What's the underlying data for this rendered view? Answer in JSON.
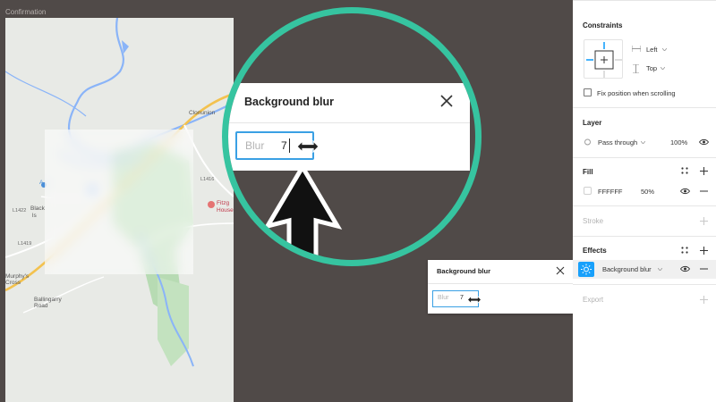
{
  "canvas": {
    "frame_label": "Confirmation",
    "map_labels": {
      "clonunion": "Clonunion",
      "fitzg": "Fitzg",
      "house": "House",
      "black": "Black",
      "ls": "ls",
      "l1422": "L1422",
      "l1419": "L1419",
      "l1416": "L1416",
      "murphys_cross": "Murphy's\nCross",
      "ballingarry_road": "Ballingarry\nRoad",
      "a_marker": "A"
    }
  },
  "zoom": {
    "title": "Background blur",
    "placeholder": "Blur",
    "value": "7"
  },
  "popup": {
    "title": "Background blur",
    "placeholder": "Blur",
    "value": "7"
  },
  "panel": {
    "constraints": {
      "title": "Constraints",
      "horizontal": "Left",
      "vertical": "Top",
      "fix_position": "Fix position when scrolling"
    },
    "layer": {
      "title": "Layer",
      "blend": "Pass through",
      "opacity": "100%"
    },
    "fill": {
      "title": "Fill",
      "hex": "FFFFFF",
      "opacity": "50%"
    },
    "stroke": {
      "title": "Stroke"
    },
    "effects": {
      "title": "Effects",
      "effect_name": "Background blur"
    },
    "export": {
      "title": "Export"
    }
  },
  "colors": {
    "canvas_bg": "#504a48",
    "accent_ring": "#36c4a0",
    "input_focus": "#3aa0e4",
    "effect_icon": "#18a0fb",
    "map_water": "#8ab4f8",
    "map_road": "#f3c24f",
    "map_park": "#a8d5a6"
  },
  "icons": [
    "close-icon",
    "resize-cursor-icon",
    "arrow-pointer-icon",
    "eye-icon",
    "plus-icon",
    "minus-icon",
    "grid-dots-icon",
    "chevron-down-icon",
    "sun-effect-icon",
    "blend-drop-icon"
  ]
}
